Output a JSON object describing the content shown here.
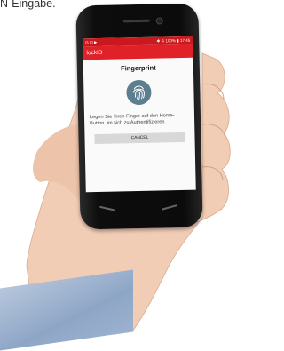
{
  "caption": "N-Eingabe.",
  "phone": {
    "status_left": "G ⊡ ▶",
    "status_right": "✱ ⇅ 100% ▮ 17:45",
    "app_title": "lockID",
    "dialog_title": "Fingerprint",
    "message": "Legen Sie Ihren Finger auf den Home-Button um sich zu Authentifizieren",
    "cancel_label": "CANCEL"
  },
  "colors": {
    "app_bar": "#e02127",
    "status_bar": "#c9181e",
    "fingerprint_circle": "#5c7e8e",
    "cancel_button": "#d8d8d8"
  },
  "icons": {
    "fingerprint": "fingerprint-icon"
  }
}
